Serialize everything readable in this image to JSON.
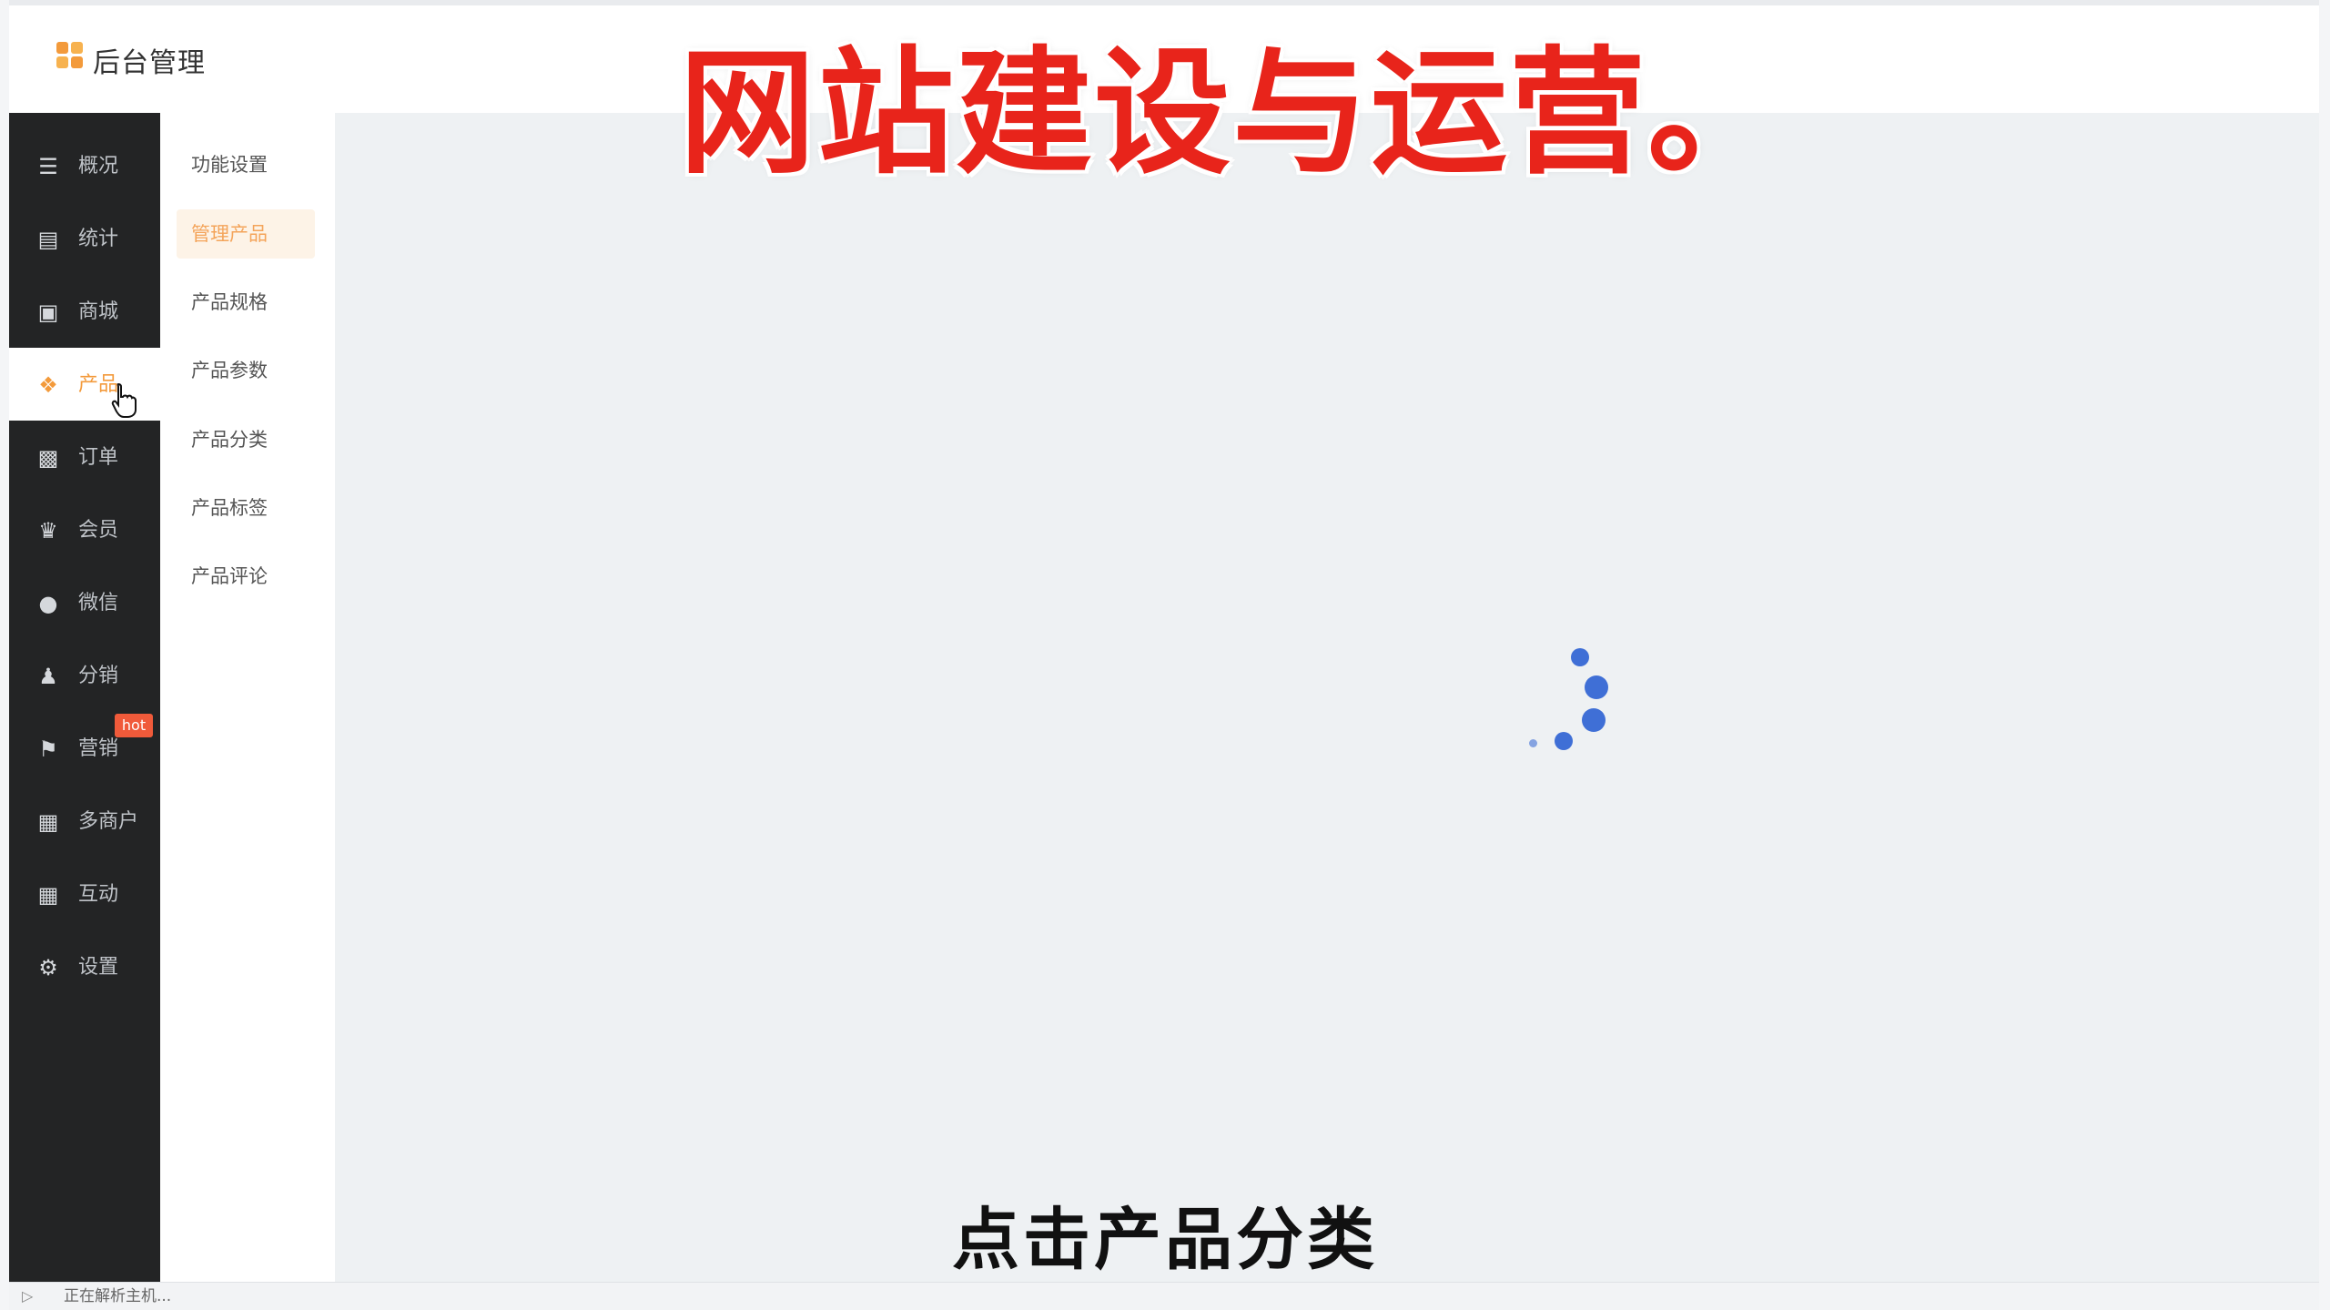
{
  "header": {
    "app_title": "后台管理",
    "logo_icon": "four-squares-icon"
  },
  "overlay": {
    "banner_text": "网站建设与运营。",
    "subtitle_text": "点击产品分类"
  },
  "sidebar": {
    "items": [
      {
        "label": "概况",
        "icon": "layers-icon"
      },
      {
        "label": "统计",
        "icon": "chart-icon"
      },
      {
        "label": "商城",
        "icon": "store-icon"
      },
      {
        "label": "产品",
        "icon": "grid-icon"
      },
      {
        "label": "订单",
        "icon": "clipboard-icon"
      },
      {
        "label": "会员",
        "icon": "crown-icon"
      },
      {
        "label": "微信",
        "icon": "chat-icon"
      },
      {
        "label": "分销",
        "icon": "people-icon"
      },
      {
        "label": "营销",
        "icon": "flag-icon"
      },
      {
        "label": "多商户",
        "icon": "shop-icon"
      },
      {
        "label": "互动",
        "icon": "apps-icon"
      },
      {
        "label": "设置",
        "icon": "gear-icon"
      }
    ],
    "active_index": 3,
    "hot_badge": "hot"
  },
  "submenu": {
    "items": [
      {
        "label": "功能设置"
      },
      {
        "label": "管理产品"
      },
      {
        "label": "产品规格"
      },
      {
        "label": "产品参数"
      },
      {
        "label": "产品分类"
      },
      {
        "label": "产品标签"
      },
      {
        "label": "产品评论"
      }
    ],
    "active_index": 1
  },
  "statusbar": {
    "text": "正在解析主机...",
    "icon": "page-icon"
  },
  "colors": {
    "accent": "#f39a3b",
    "sidebar_bg": "#232425",
    "banner_red": "#e8241b",
    "spinner_blue": "#3f6fd6",
    "content_bg": "#eef1f3"
  }
}
